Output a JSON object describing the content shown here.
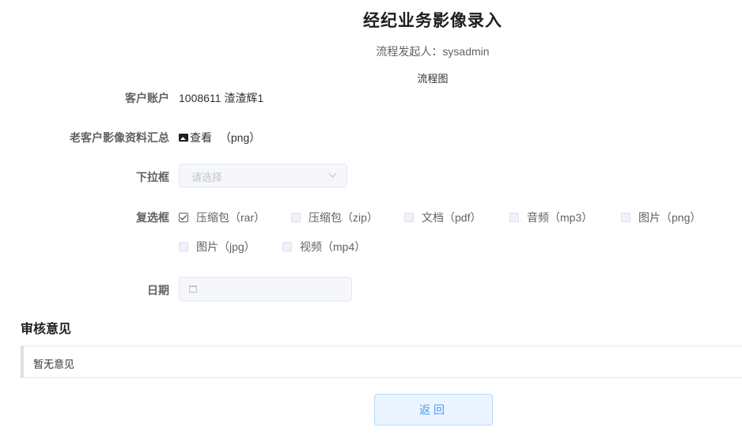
{
  "header": {
    "title": "经纪业务影像录入",
    "initiator": "流程发起人：sysadmin",
    "flowchart_link": "流程图"
  },
  "form": {
    "account": {
      "label": "客户账户",
      "value": "1008611 渣渣辉1"
    },
    "old_images": {
      "label": "老客户影像资料汇总",
      "link_text": "查看",
      "format": "（png）",
      "icon": "image-icon"
    },
    "dropdown": {
      "label": "下拉框",
      "placeholder": "请选择",
      "icon": "chevron-down-icon"
    },
    "checkboxes": {
      "label": "复选框",
      "items": [
        {
          "label": "压缩包（rar）",
          "checked": true
        },
        {
          "label": "压缩包（zip）",
          "checked": false
        },
        {
          "label": "文档（pdf）",
          "checked": false
        },
        {
          "label": "音频（mp3）",
          "checked": false
        },
        {
          "label": "图片（png）",
          "checked": false
        },
        {
          "label": "图片（jpg）",
          "checked": false
        },
        {
          "label": "视频（mp4）",
          "checked": false
        }
      ]
    },
    "date": {
      "label": "日期",
      "icon": "calendar-icon"
    }
  },
  "review": {
    "title": "审核意见",
    "text": "暂无意见"
  },
  "actions": {
    "back_label": "返回"
  },
  "colors": {
    "primary": "#409eff",
    "button_bg": "#ecf5ff",
    "disabled_bg": "#f5f7fa"
  }
}
